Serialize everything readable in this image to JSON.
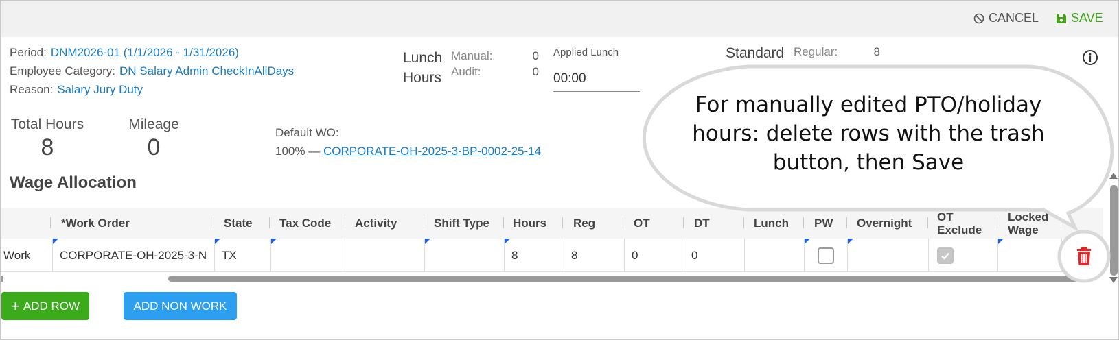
{
  "toolbar": {
    "cancel_label": "CANCEL",
    "save_label": "SAVE"
  },
  "info": {
    "period_label": "Period:",
    "period_value": "DNM2026-01 (1/1/2026 - 1/31/2026)",
    "category_label": "Employee Category:",
    "category_value": "DN Salary Admin CheckInAllDays",
    "reason_label": "Reason:",
    "reason_value": "Salary Jury Duty"
  },
  "lunch": {
    "title_line1": "Lunch",
    "title_line2": "Hours",
    "manual_label": "Manual:",
    "manual_value": "0",
    "audit_label": "Audit:",
    "audit_value": "0",
    "applied_label": "Applied Lunch",
    "applied_value": "00:00"
  },
  "standard": {
    "title": "Standard",
    "regular_label": "Regular:",
    "regular_value": "8"
  },
  "totals": {
    "total_hours_label": "Total Hours",
    "total_hours_value": "8",
    "mileage_label": "Mileage",
    "mileage_value": "0"
  },
  "default_wo": {
    "label": "Default WO:",
    "percent": "100% —",
    "link": "CORPORATE-OH-2025-3-BP-0002-25-14"
  },
  "wage_allocation": {
    "title": "Wage Allocation",
    "columns": [
      "*Work Order",
      "State",
      "Tax Code",
      "Activity",
      "Shift Type",
      "Hours",
      "Reg",
      "OT",
      "DT",
      "Lunch",
      "PW",
      "Overnight",
      "OT\nExclude",
      "Locked\nWage"
    ],
    "row": {
      "type": "Work",
      "work_order": "CORPORATE-OH-2025-3-N",
      "state": "TX",
      "tax_code": "",
      "activity": "",
      "shift_type": "",
      "hours": "8",
      "reg": "8",
      "ot": "0",
      "dt": "0",
      "lunch": "",
      "pw_checked": false,
      "overnight": "",
      "ot_exclude_checked": true,
      "locked_wage": ""
    }
  },
  "buttons": {
    "add_row_label": "ADD ROW",
    "add_non_work_label": "ADD NON WORK"
  },
  "callout": {
    "line1": "For manually edited PTO/holiday",
    "line2": "hours: delete rows with the trash",
    "line3": "button, then Save"
  },
  "colors": {
    "link": "#1a7dc4",
    "save": "#43a31a",
    "add_row": "#3bab1c",
    "add_non_work": "#2d9ff0",
    "trash": "#e0262b"
  },
  "icons": [
    "cancel-icon",
    "save-icon",
    "info-icon",
    "plus-icon",
    "trash-icon",
    "check-icon"
  ]
}
